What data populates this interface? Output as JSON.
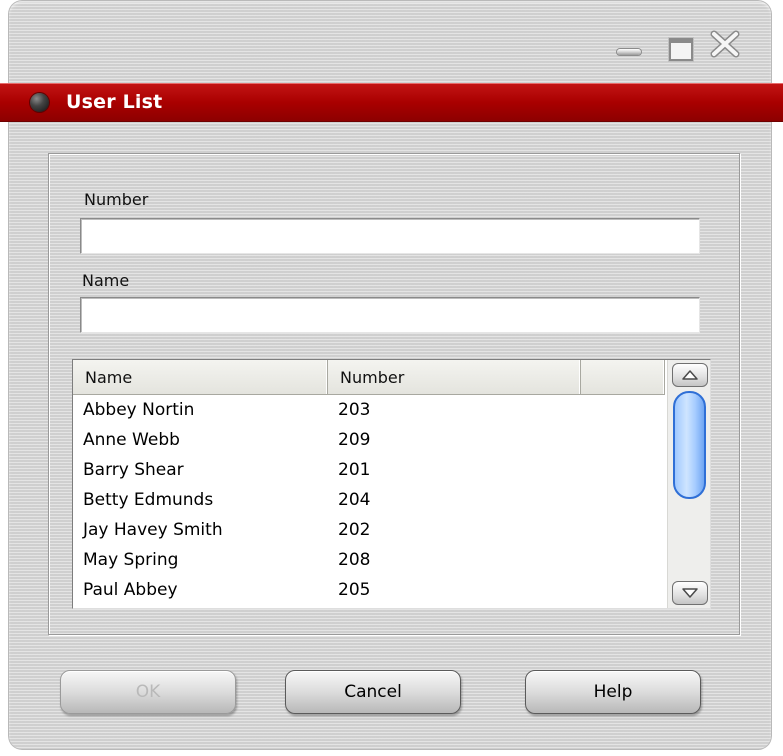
{
  "window": {
    "title": "User List",
    "controls": [
      "minimize-icon",
      "maximize-icon",
      "close-icon"
    ],
    "accent_color": "#a90000"
  },
  "form": {
    "number_label": "Number",
    "number_value": "",
    "name_label": "Name",
    "name_value": ""
  },
  "list": {
    "columns": [
      "Name",
      "Number",
      ""
    ],
    "rows": [
      {
        "name": "Abbey Nortin",
        "number": "203"
      },
      {
        "name": "Anne Webb",
        "number": "209"
      },
      {
        "name": "Barry Shear",
        "number": "201"
      },
      {
        "name": "Betty Edmunds",
        "number": "204"
      },
      {
        "name": "Jay Havey Smith",
        "number": "202"
      },
      {
        "name": "May Spring",
        "number": "208"
      },
      {
        "name": "Paul Abbey",
        "number": "205"
      }
    ],
    "scroll_icons": [
      "scroll-up-arrow-icon",
      "scroll-down-arrow-icon"
    ]
  },
  "buttons": {
    "ok_label": "OK",
    "ok_enabled": false,
    "cancel_label": "Cancel",
    "help_label": "Help"
  }
}
